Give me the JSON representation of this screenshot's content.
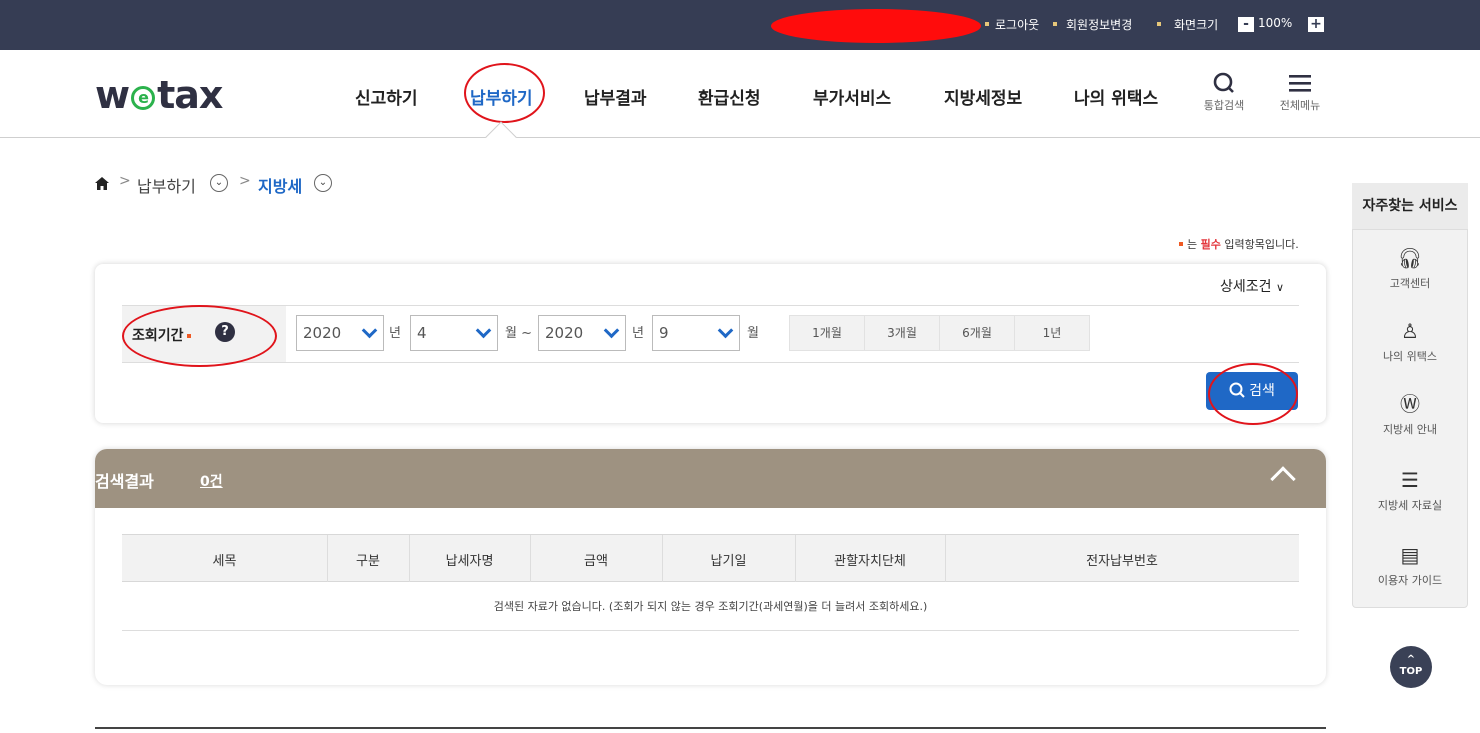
{
  "topbar": {
    "logout": "로그아웃",
    "member_edit": "회원정보변경",
    "screen_size": "화면크기",
    "zoom_minus": "-",
    "zoom_value": "100%",
    "zoom_plus": "+"
  },
  "header": {
    "logo_left": "w",
    "logo_e": "e",
    "logo_right": "tax",
    "nav": [
      "신고하기",
      "납부하기",
      "납부결과",
      "환급신청",
      "부가서비스",
      "지방세정보",
      "나의 위택스"
    ],
    "search_label": "통합검색",
    "menu_label": "전체메뉴"
  },
  "breadcrumb": {
    "level1": "납부하기",
    "level2": "지방세"
  },
  "required_note": {
    "prefix": "는",
    "required": "필수",
    "suffix": "입력항목입니다."
  },
  "search": {
    "detail_toggle": "상세조건",
    "period_label": "조회기간",
    "help": "?",
    "from_year": "2020",
    "from_month": "4",
    "to_year": "2020",
    "to_month": "9",
    "unit_year": "년",
    "unit_month_tilde": "월 ~",
    "unit_month": "월",
    "periods": [
      "1개월",
      "3개월",
      "6개월",
      "1년"
    ],
    "search_button": "검색"
  },
  "results": {
    "title": "검색결과",
    "count": "0건",
    "columns": [
      "세목",
      "구분",
      "납세자명",
      "금액",
      "납기일",
      "관할자치단체",
      "전자납부번호"
    ],
    "empty_message": "검색된 자료가 없습니다. (조회가 되지 않는 경우 조회기간(과세연월)을 더 늘려서 조회하세요.)"
  },
  "quick_menu": {
    "title": "자주찾는 서비스",
    "items": [
      "고객센터",
      "나의 위택스",
      "지방세 안내",
      "지방세 자료실",
      "이용자 가이드"
    ],
    "top": "TOP"
  },
  "colors": {
    "accent": "#1f68c6",
    "topbar": "#363d54",
    "result_header": "#9e9281",
    "annotation": "#e0141b"
  }
}
